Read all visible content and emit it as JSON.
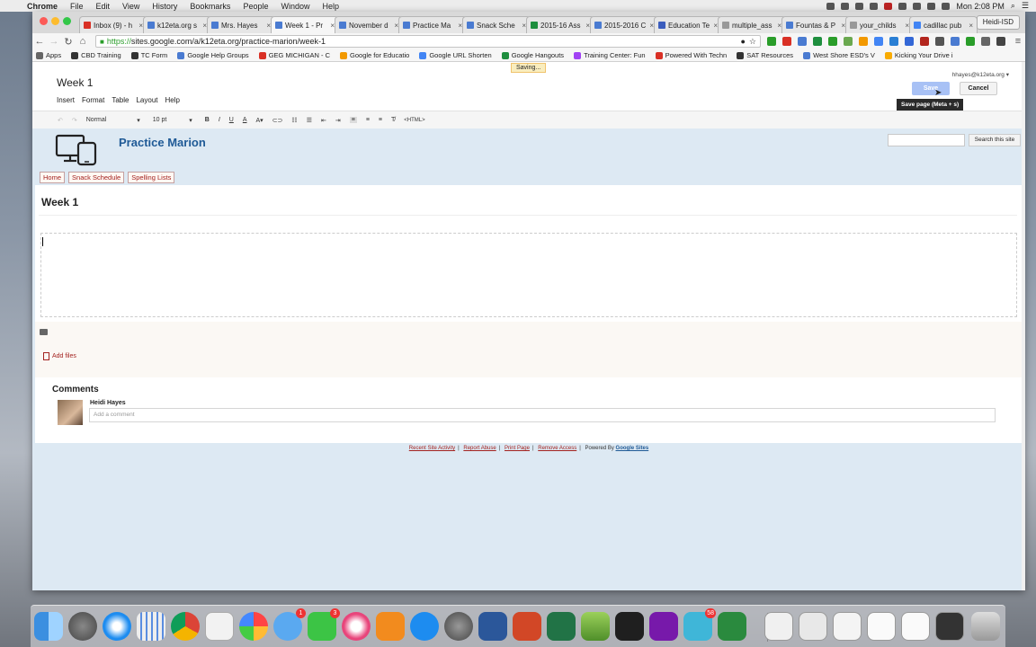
{
  "menubar": {
    "app_name": "Chrome",
    "items": [
      "File",
      "Edit",
      "View",
      "History",
      "Bookmarks",
      "People",
      "Window",
      "Help"
    ],
    "clock": "Mon 2:08 PM"
  },
  "tabs": [
    {
      "title": "Inbox (9) - h",
      "icon": "gmail-icon",
      "color": "#d93025"
    },
    {
      "title": "k12eta.org s",
      "icon": "doc-icon",
      "color": "#4a7bd1"
    },
    {
      "title": "Mrs. Hayes",
      "icon": "sites-icon",
      "color": "#4a7bd1"
    },
    {
      "title": "Week 1 - Pr",
      "icon": "sites-icon",
      "color": "#4a7bd1",
      "active": true
    },
    {
      "title": "November d",
      "icon": "doc-icon",
      "color": "#4a7bd1"
    },
    {
      "title": "Practice Ma",
      "icon": "doc-icon",
      "color": "#4a7bd1"
    },
    {
      "title": "Snack Sche",
      "icon": "doc-icon",
      "color": "#4a7bd1"
    },
    {
      "title": "2015-16 Ass",
      "icon": "sheets-icon",
      "color": "#1e8e3e"
    },
    {
      "title": "2015-2016 C",
      "icon": "sites-icon",
      "color": "#4a7bd1"
    },
    {
      "title": "Education Te",
      "icon": "doc-icon",
      "color": "#3b5dbd"
    },
    {
      "title": "multiple_ass",
      "icon": "file-icon",
      "color": "#999999"
    },
    {
      "title": "Fountas & P",
      "icon": "sites-icon",
      "color": "#4a7bd1"
    },
    {
      "title": "your_childs",
      "icon": "file-icon",
      "color": "#999999"
    },
    {
      "title": "cadillac pub",
      "icon": "google-icon",
      "color": "#4285f4"
    }
  ],
  "profile_name": "Heidi-ISD",
  "omnibox": {
    "scheme": "https://",
    "rest": "sites.google.com/a/k12eta.org/practice-marion/week-1"
  },
  "bookmarks": [
    {
      "label": "Apps",
      "color": "#666666"
    },
    {
      "label": "CBD Training",
      "color": "#333333"
    },
    {
      "label": "TC Form",
      "color": "#333333"
    },
    {
      "label": "Google Help Groups",
      "color": "#4a7bd1"
    },
    {
      "label": "GEG MICHIGAN - C",
      "color": "#d93025"
    },
    {
      "label": "Google for Educatio",
      "color": "#f29900"
    },
    {
      "label": "Google URL Shorten",
      "color": "#4285f4"
    },
    {
      "label": "Google Hangouts",
      "color": "#1e8e3e"
    },
    {
      "label": "Training Center: Fun",
      "color": "#a142f4"
    },
    {
      "label": "Powered With Techn",
      "color": "#d93025"
    },
    {
      "label": "SAT Resources",
      "color": "#333333"
    },
    {
      "label": "West Shore ESD's V",
      "color": "#4a7bd1"
    },
    {
      "label": "Kicking Your Drive i",
      "color": "#f9ab00"
    }
  ],
  "saving_label": "Saving...",
  "user_email": "hhayes@k12eta.org",
  "editor": {
    "title": "Week 1",
    "menus": [
      "Insert",
      "Format",
      "Table",
      "Layout",
      "Help"
    ],
    "save_label": "Save",
    "cancel_label": "Cancel",
    "tooltip": "Save page (Meta + s)",
    "format_select": "Normal",
    "size_select": "10 pt",
    "html_label": "<HTML>"
  },
  "site": {
    "title": "Practice Marion",
    "search_button": "Search this site",
    "nav": [
      "Home",
      "Snack Schedule",
      "Spelling Lists"
    ],
    "page_heading": "Week 1",
    "add_files": "Add files"
  },
  "comments": {
    "title": "Comments",
    "author": "Heidi Hayes",
    "placeholder": "Add a comment"
  },
  "footer": {
    "links": [
      "Recent Site Activity",
      "Report Abuse",
      "Print Page",
      "Remove Access"
    ],
    "powered_by": "Powered By",
    "google_sites": "Google Sites"
  },
  "dock": {
    "messages_badge": "1",
    "facetime_badge": "3",
    "appstore_badge": "58"
  },
  "colors": {
    "sites_header_bg": "#dde9f3",
    "site_title": "#1f5a96",
    "link_red": "#a3221f",
    "save_button": "#a8c1f5"
  }
}
